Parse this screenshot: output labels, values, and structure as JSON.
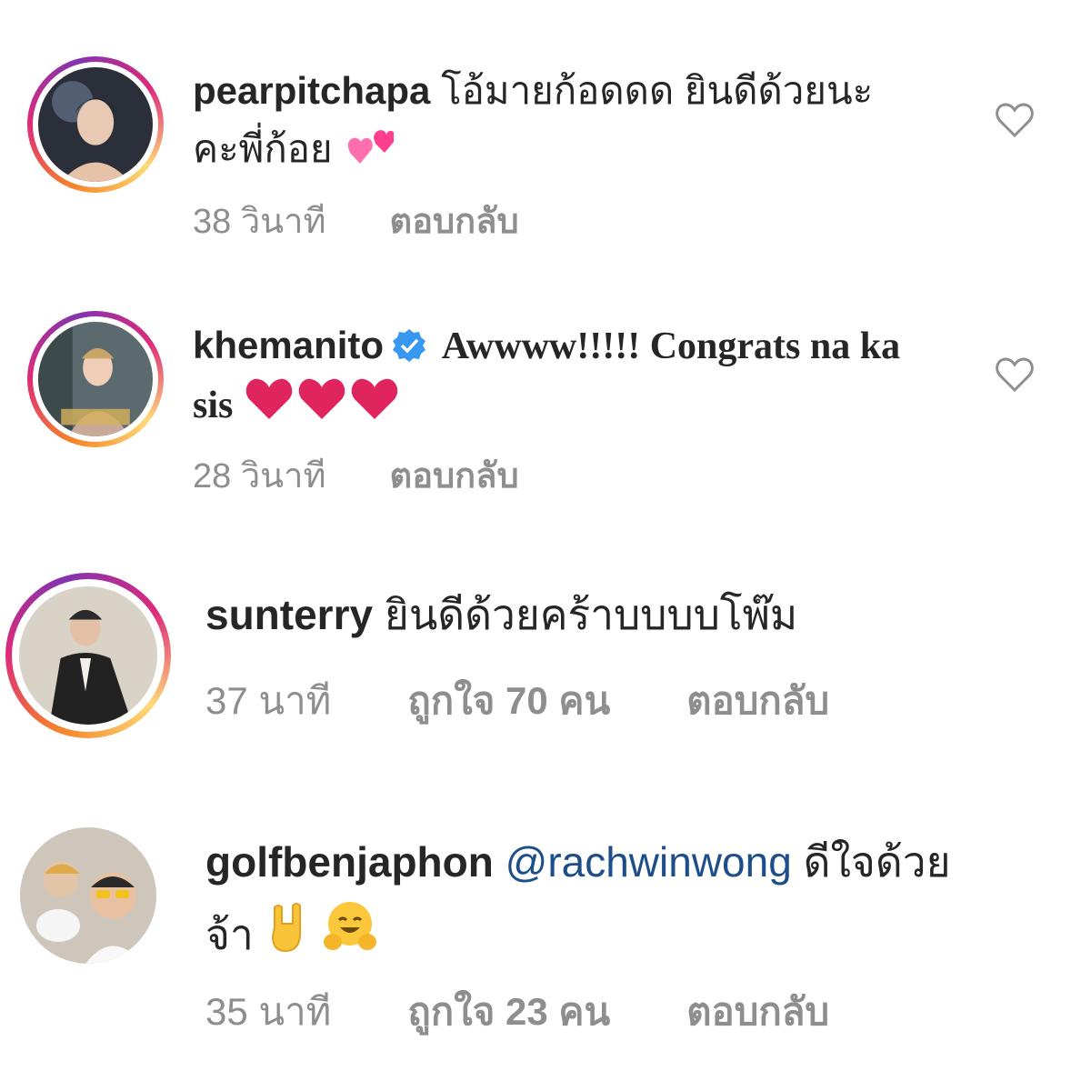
{
  "comments": [
    {
      "username": "pearpitchapa",
      "text_line1": "โอ้มายก้อดดด ยินดีด้วยนะ",
      "text_line2": "คะพี่ก้อย",
      "emoji": "two-hearts",
      "time": "38 วินาที",
      "reply": "ตอบกลับ"
    },
    {
      "username": "khemanito",
      "verified": true,
      "text_line1": "Awwww!!!!! Congrats na ka",
      "text_line2": "sis",
      "emoji": "red-heart x3",
      "time": "28 วินาที",
      "reply": "ตอบกลับ"
    },
    {
      "username": "sunterry",
      "text_line1": "ยินดีด้วยคร้าบบบบโพ๊ม",
      "time": "37 นาที",
      "likes": "ถูกใจ 70 คน",
      "reply": "ตอบกลับ"
    },
    {
      "username": "golfbenjaphon",
      "mention": "@rachwinwong",
      "text_line1": "ดีใจด้วย",
      "text_line2": "จ้า",
      "emoji": "rock-hand, hugging-face",
      "time": "35 นาที",
      "likes": "ถูกใจ 23 คน",
      "reply": "ตอบกลับ"
    }
  ],
  "colors": {
    "text": "#262626",
    "meta": "#8e8e8e",
    "mention": "#1d4e89",
    "verified": "#3897f0",
    "heart": "#e0245e"
  }
}
